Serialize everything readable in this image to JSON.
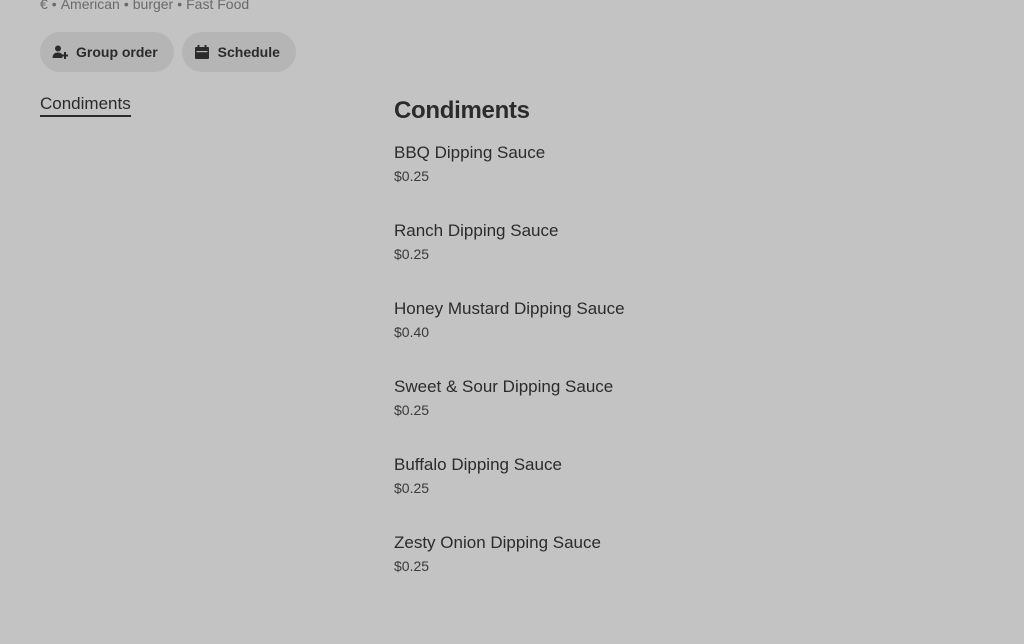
{
  "store": {
    "tags": [
      "€",
      "American",
      "burger",
      "Fast Food"
    ]
  },
  "actions": {
    "group_order_label": "Group order",
    "schedule_label": "Schedule"
  },
  "nav": {
    "items": [
      {
        "label": "Condiments"
      }
    ]
  },
  "menu": {
    "section_title": "Condiments",
    "items": [
      {
        "name": "BBQ Dipping Sauce",
        "price": "$0.25"
      },
      {
        "name": "Ranch Dipping Sauce",
        "price": "$0.25"
      },
      {
        "name": "Honey Mustard Dipping Sauce",
        "price": "$0.40"
      },
      {
        "name": "Sweet & Sour Dipping Sauce",
        "price": "$0.25"
      },
      {
        "name": "Buffalo Dipping Sauce",
        "price": "$0.25"
      },
      {
        "name": "Zesty Onion Dipping Sauce",
        "price": "$0.25"
      }
    ]
  },
  "icons": {
    "group_order": "person-add-icon",
    "schedule": "calendar-icon"
  }
}
